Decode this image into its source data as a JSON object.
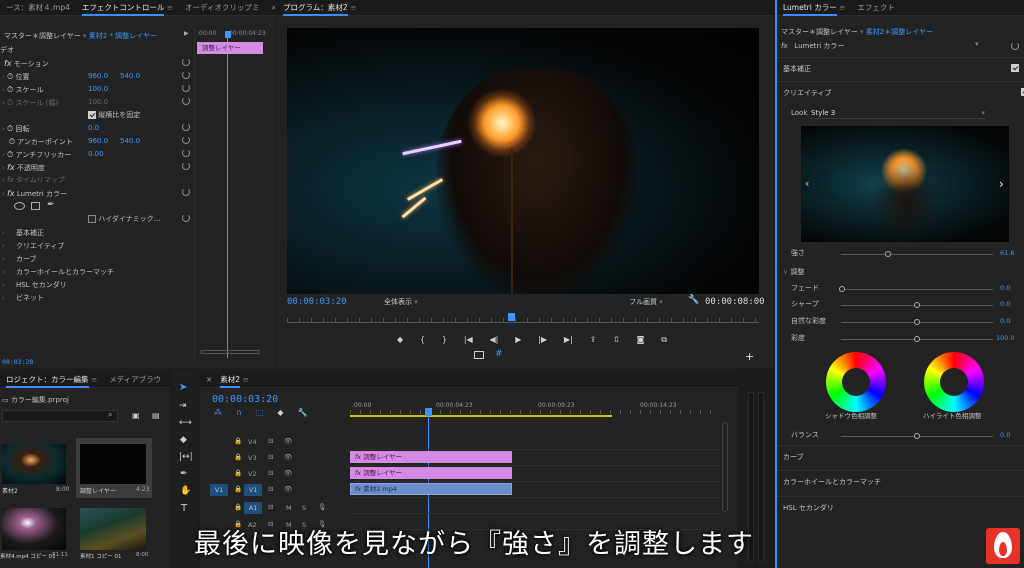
{
  "source_panel": {
    "tab_source": "ース：素材４.mp4",
    "tab_effect": "エフェクトコントロール",
    "tab_audio": "オーディオクリップミ",
    "expand_more": "»",
    "master_label": "マスター＊調整レイヤー",
    "clip_label": "素材2 * 調整レイヤー",
    "ruler_start": ":00:00",
    "ruler_mid": "00:00:04:23",
    "timeline_clip": "調整レイヤー",
    "section_video": "デオ",
    "rows": {
      "motion": "モーション",
      "position": "位置",
      "position_x": "960.0",
      "position_y": "540.0",
      "scale": "スケール",
      "scale_val": "100.0",
      "scale_w": "スケール (幅)",
      "scale_w_val": "100.0",
      "uniform": "縦横比を固定",
      "rotation": "回転",
      "rotation_val": "0.0",
      "anchor": "アンカーポイント",
      "anchor_x": "960.0",
      "anchor_y": "540.0",
      "antiflicker": "アンチフリッカー",
      "antiflicker_val": "0.00",
      "opacity": "不透明度",
      "timeremap": "タイムリマップ",
      "lumetri": "Lumetri カラー",
      "hdr": "ハイダイナミック...",
      "basic": "基本補正",
      "creative": "クリエイティブ",
      "curves": "カーブ",
      "wheels": "カラーホイールとカラーマッチ",
      "hsl": "HSL セカンダリ",
      "vignette": "ビネット"
    },
    "bottom_tc": "00:03:20"
  },
  "program": {
    "title": "プログラム：素材2",
    "menu_icon": "≡",
    "timecode": "00:00:03:20",
    "fit": "全体表示",
    "quality": "フル画質",
    "duration": "00:00:08:00"
  },
  "lumetri": {
    "tab": "Lumetri カラー",
    "tab2": "エフェクト",
    "master": "マスター＊調整レイヤー",
    "clip": "素材2＊調整レイヤー",
    "fx_name": "Lumetri カラー",
    "basic": "基本補正",
    "creative": "クリエイティブ",
    "look_label": "Look",
    "look_value": "Style 3",
    "intensity_label": "強さ",
    "intensity_value": "61.6",
    "adjust": "調整",
    "fade": "フェード",
    "fade_val": "0.0",
    "sharpen": "シャープ",
    "sharpen_val": "0.0",
    "vibrance": "自然な彩度",
    "vibrance_val": "0.0",
    "saturation": "彩度",
    "saturation_val": "100.0",
    "shadow_tint": "シャドウ色相調整",
    "highlight_tint": "ハイライト色相調整",
    "balance": "バランス",
    "balance_val": "0.0",
    "curves": "カーブ",
    "wheels": "カラーホイールとカラーマッチ",
    "hsl": "HSL セカンダリ"
  },
  "project": {
    "tab": "ロジェクト：カラー編集",
    "tab2": "メディアブラウ",
    "file": "カラー編集.prproj",
    "items": [
      {
        "name": "素材2",
        "dur": "8:00"
      },
      {
        "name": "調整レイヤー",
        "dur": "4:23"
      },
      {
        "name": "素材4.mp4 コピー 01",
        "dur": "31:11"
      },
      {
        "name": "素材1 コピー 01",
        "dur": "8:00"
      }
    ]
  },
  "timeline": {
    "tab": "素材2",
    "timecode": "00:00:03:20",
    "ruler": [
      ":00:00",
      "00:00:04:23",
      "00:00:09:23",
      "00:00:14:23"
    ],
    "tracks": [
      "V4",
      "V3",
      "V2",
      "V1",
      "A1",
      "A2"
    ],
    "src_v1": "V1",
    "src_a1": "A1",
    "clip_v3": "調整レイヤー",
    "clip_v2": "調整レイヤー",
    "clip_v1": "素材2.mp4",
    "m": "M",
    "s": "S"
  },
  "subtitle": "最後に映像を見ながら『強さ』を調整します",
  "colors": {
    "accent": "#3d96ff",
    "clip_pink": "#d58be6",
    "clip_blue": "#6d8cc9"
  }
}
